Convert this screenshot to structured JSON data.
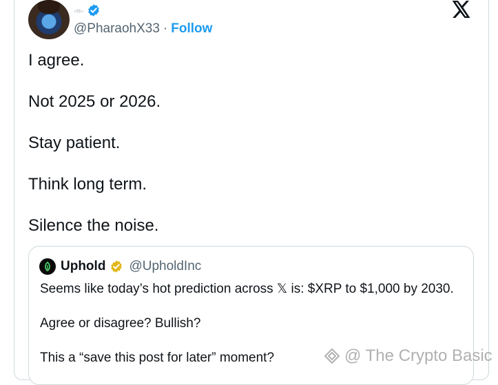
{
  "author": {
    "name_glyph": "𓁹",
    "handle": "@PharaohX33",
    "separator": "·",
    "follow_label": "Follow"
  },
  "tweet": {
    "lines": [
      "I agree.",
      "Not 2025 or 2026.",
      "Stay patient.",
      "Think long term.",
      "Silence the noise."
    ]
  },
  "quote": {
    "name": "Uphold",
    "handle": "@UpholdInc",
    "lines": [
      "Seems like today’s hot prediction across 𝕏 is: $XRP to $1,000 by 2030.",
      "Agree or disagree? Bullish?",
      "This a “save this post for later” moment?"
    ]
  },
  "watermark": {
    "text": "@ The Crypto Basic"
  },
  "colors": {
    "accent": "#1d9bf0",
    "gold_badge": "#e2b719",
    "muted": "#536471",
    "border": "#cfd9de"
  },
  "icons": [
    "verified-badge-icon",
    "x-logo-icon",
    "uphold-logo-icon",
    "gold-verified-badge-icon",
    "watermark-logo-icon"
  ]
}
